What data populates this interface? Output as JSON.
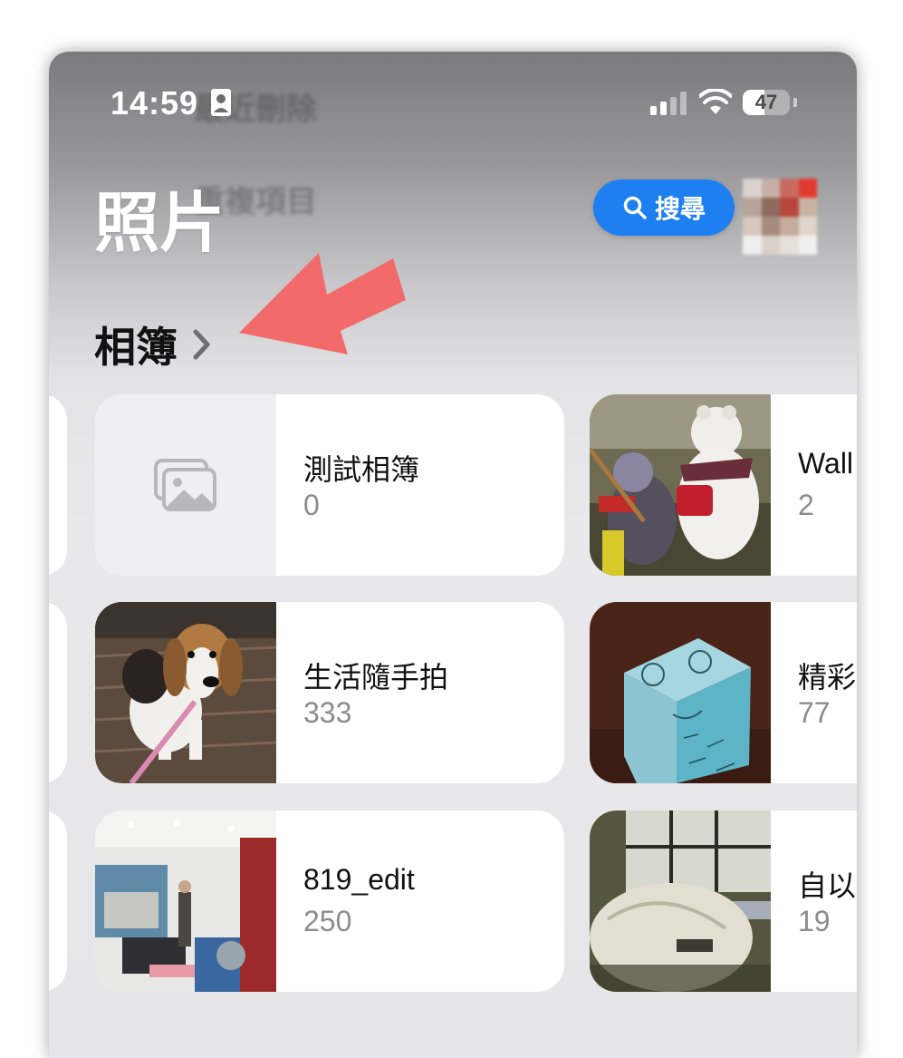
{
  "status_bar": {
    "time": "14:59",
    "battery": "47",
    "battery_level": 0.47
  },
  "background_ghost": {
    "line1": "最近刪除",
    "line2": "重複項目"
  },
  "header": {
    "title": "照片",
    "search_label": "搜尋"
  },
  "albums_section": {
    "heading": "相簿"
  },
  "albums": [
    {
      "name": "測試相簿",
      "count": "0"
    },
    {
      "name": "Wall",
      "count": "2"
    },
    {
      "name": "生活隨手拍",
      "count": "333"
    },
    {
      "name": "精彩",
      "count": "77"
    },
    {
      "name": "819_edit",
      "count": "250"
    },
    {
      "name": "自以",
      "count": "19"
    }
  ],
  "colors": {
    "accent": "#1e7ff0",
    "annotation_arrow": "#f26a6a",
    "count_text": "#8c8c90"
  }
}
